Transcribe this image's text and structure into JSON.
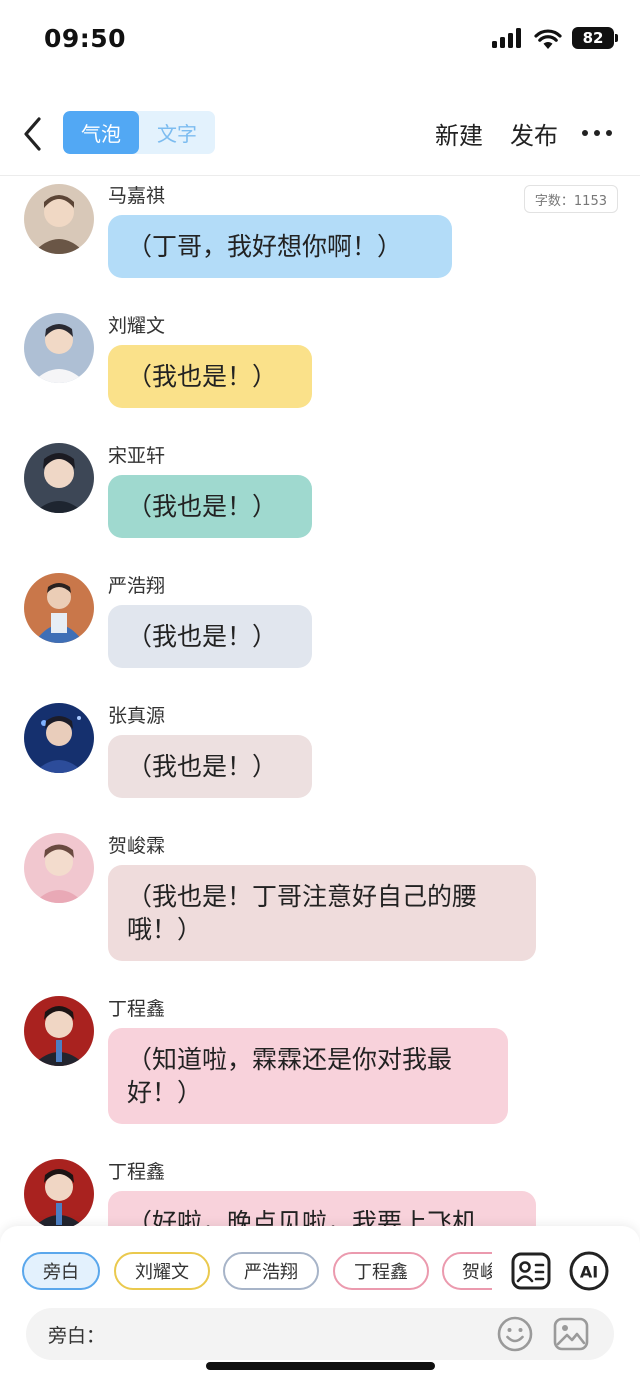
{
  "status_bar": {
    "time": "09:50",
    "battery": "82"
  },
  "nav": {
    "tabs": [
      {
        "label": "气泡",
        "active": true
      },
      {
        "label": "文字",
        "active": false
      }
    ],
    "new_label": "新建",
    "publish_label": "发布"
  },
  "word_count": "字数：1153",
  "messages": [
    {
      "sender": "马嘉祺",
      "text": "（丁哥，我好想你啊！）",
      "bubble_color": "#b3dcf8"
    },
    {
      "sender": "刘耀文",
      "text": "（我也是！）",
      "bubble_color": "#fae18a"
    },
    {
      "sender": "宋亚轩",
      "text": "（我也是！）",
      "bubble_color": "#9fd9cf"
    },
    {
      "sender": "严浩翔",
      "text": "（我也是！）",
      "bubble_color": "#e1e6ee"
    },
    {
      "sender": "张真源",
      "text": "（我也是！）",
      "bubble_color": "#ede0e0"
    },
    {
      "sender": "贺峻霖",
      "text": "（我也是！丁哥注意好自己的腰哦！）",
      "bubble_color": "#efdcdc"
    },
    {
      "sender": "丁程鑫",
      "text": "（知道啦，霖霖还是你对我最好！）",
      "bubble_color": "#f8d2db"
    },
    {
      "sender": "丁程鑫",
      "text": "（好啦，晚点见啦，我要上飞机",
      "bubble_color": "#f8d2db"
    }
  ],
  "role_chips": [
    {
      "label": "旁白",
      "selected": true,
      "color": "#5aa7ec"
    },
    {
      "label": "刘耀文",
      "selected": false,
      "color": "#eac94e"
    },
    {
      "label": "严浩翔",
      "selected": false,
      "color": "#a7b4c8"
    },
    {
      "label": "丁程鑫",
      "selected": false,
      "color": "#eb9aae"
    },
    {
      "label": "贺峻",
      "selected": false,
      "color": "#eb9aae"
    }
  ],
  "input": {
    "label": "旁白："
  },
  "colors": {
    "accent": "#52a8f4",
    "toggle_bg": "#e3f2fd"
  }
}
